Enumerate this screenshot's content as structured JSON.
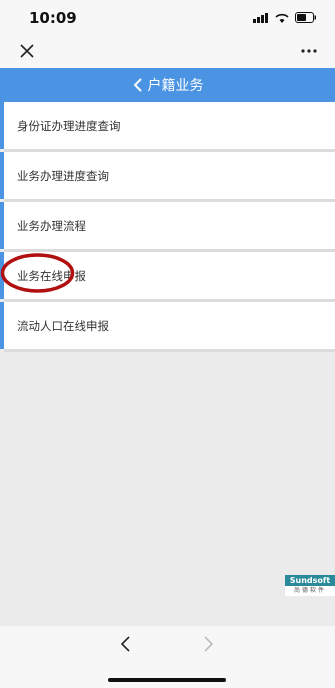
{
  "status": {
    "time": "10:09"
  },
  "header": {
    "title": "户籍业务"
  },
  "menu": [
    {
      "label": "身份证办理进度查询"
    },
    {
      "label": "业务办理进度查询"
    },
    {
      "label": "业务办理流程"
    },
    {
      "label": "业务在线申报"
    },
    {
      "label": "流动人口在线申报"
    }
  ],
  "logo": {
    "top": "Sundsoft",
    "bottom": "尚德软件"
  },
  "colors": {
    "accent": "#4a94e3",
    "highlight_circle": "#b01010"
  },
  "icons": [
    "close-icon",
    "more-icon",
    "chevron-left-icon",
    "signal-icon",
    "wifi-icon",
    "battery-icon"
  ]
}
